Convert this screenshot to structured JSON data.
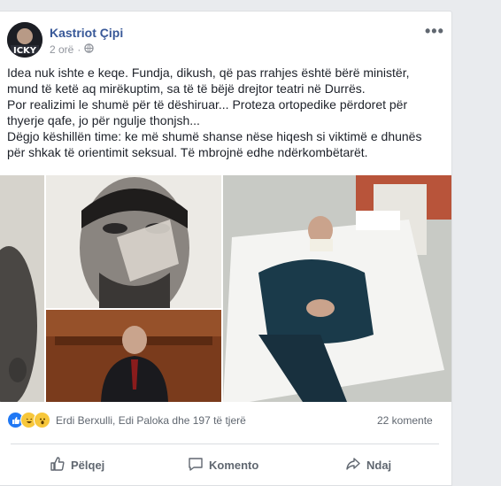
{
  "post": {
    "author": "Kastriot Çipi",
    "time": "2 orë",
    "privacy_icon": "globe-icon",
    "text": [
      "Idea nuk ishte e keqe. Fundja, dikush, që pas rrahjes është bërë ministër, mund të ketë aq mirëkuptim, sa të të bëjë drejtor teatri në Durrës.",
      "Por realizimi le shumë për të dëshiruar... Proteza ortopedike përdoret për thyerje qafe, jo për ngulje thonjsh...",
      "Dëgjo këshillën time: ke më shumë shanse nëse hiqesh si viktimë e dhunës për shkak të orientimit seksual. Të mbrojnë edhe ndërkombëtarët."
    ]
  },
  "reactions": {
    "names": "Erdi Berxulli, Edi Paloka dhe 197 të tjerë",
    "comments": "22 komente"
  },
  "actions": {
    "like": "Pëlqej",
    "comment": "Komento",
    "share": "Ndaj"
  },
  "colors": {
    "link": "#385898",
    "like_blue": "#2078f4"
  }
}
